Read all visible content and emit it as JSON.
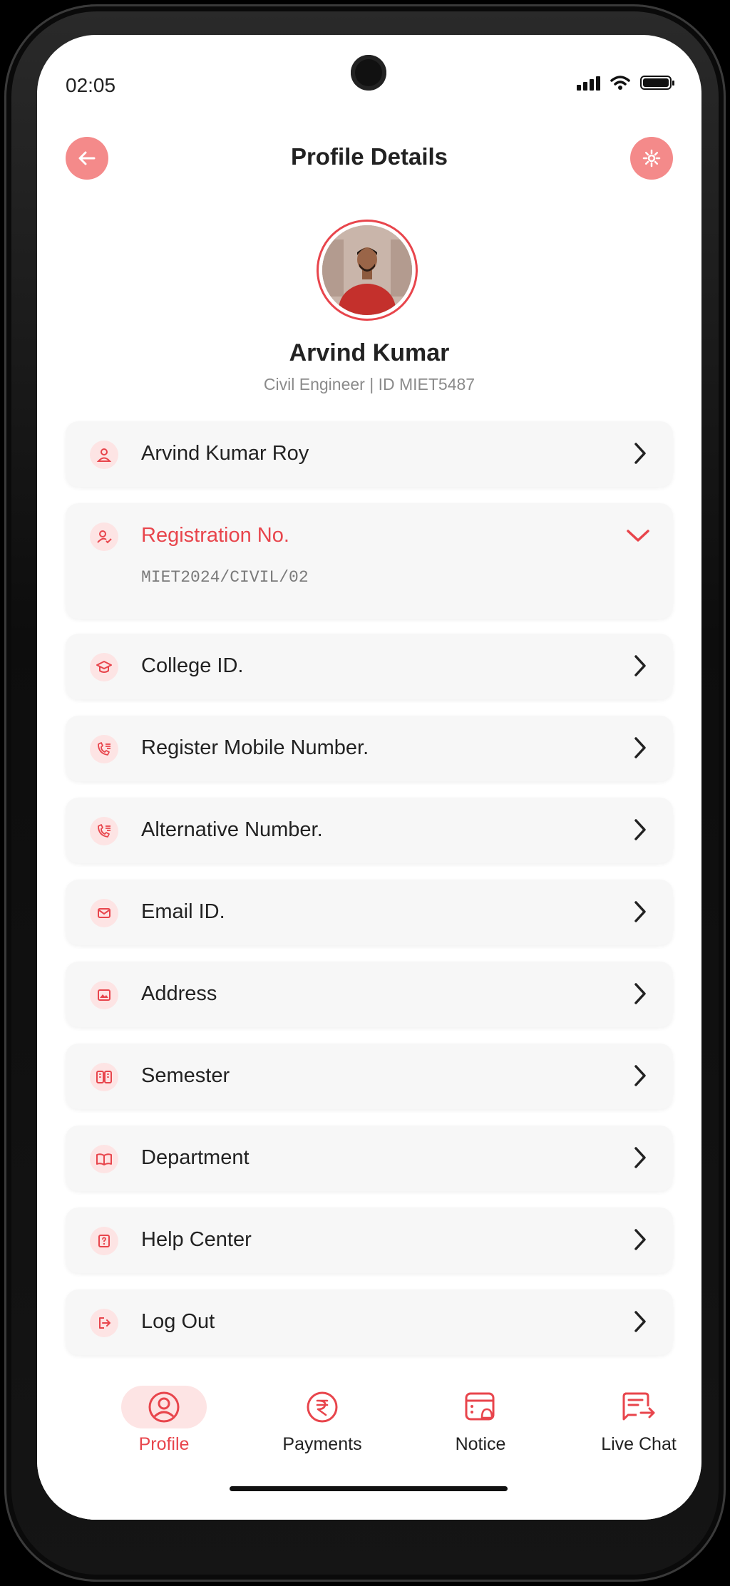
{
  "status_bar": {
    "time": "02:05"
  },
  "header": {
    "title": "Profile Details",
    "back_icon": "arrow-left-icon",
    "settings_icon": "gear-icon"
  },
  "profile": {
    "name": "Arvind Kumar",
    "subtitle": "Civil Engineer | ID MIET5487"
  },
  "items": [
    {
      "label": "Arvind Kumar Roy",
      "icon": "user-icon"
    },
    {
      "label": "Registration No.",
      "icon": "user-check-icon",
      "value": "MIET2024/CIVIL/02",
      "expanded": true
    },
    {
      "label": "College ID.",
      "icon": "graduation-cap-icon"
    },
    {
      "label": "Register Mobile Number.",
      "icon": "phone-list-icon"
    },
    {
      "label": "Alternative Number.",
      "icon": "phone-list-icon"
    },
    {
      "label": "Email ID.",
      "icon": "mail-icon"
    },
    {
      "label": "Address",
      "icon": "image-card-icon"
    },
    {
      "label": "Semester",
      "icon": "columns-icon"
    },
    {
      "label": "Department",
      "icon": "book-icon"
    },
    {
      "label": "Help Center",
      "icon": "help-icon"
    },
    {
      "label": "Log Out",
      "icon": "logout-icon"
    }
  ],
  "bottom_nav": [
    {
      "label": "Profile",
      "icon": "profile-icon",
      "active": true
    },
    {
      "label": "Payments",
      "icon": "rupee-icon",
      "active": false
    },
    {
      "label": "Notice",
      "icon": "notice-icon",
      "active": false
    },
    {
      "label": "Live Chat",
      "icon": "chat-icon",
      "active": false
    }
  ],
  "colors": {
    "accent": "#e8454c",
    "accent_soft": "#fde4e4",
    "card": "#f7f7f7"
  }
}
